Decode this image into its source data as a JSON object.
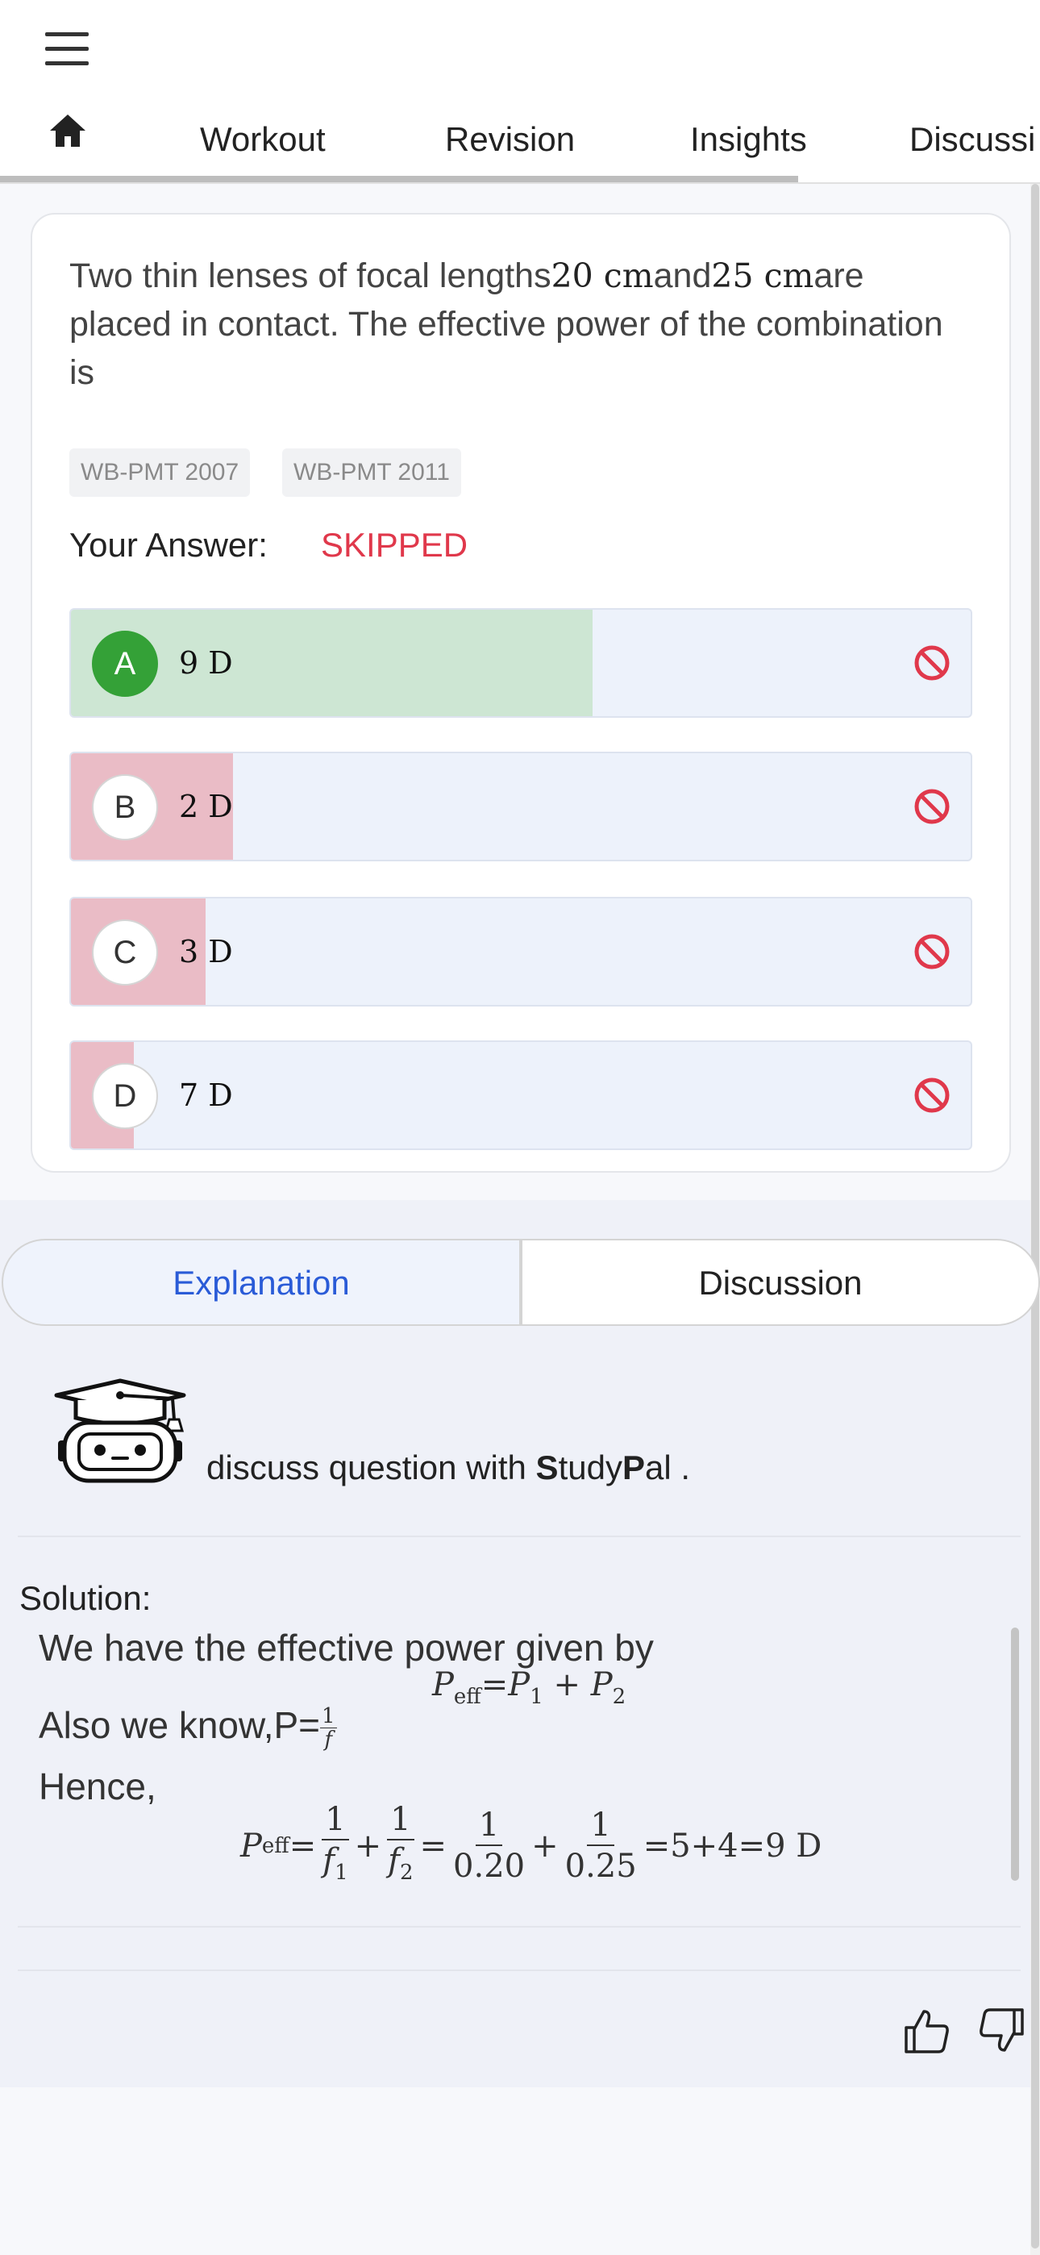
{
  "nav": {
    "tabs": [
      {
        "label": "Workout"
      },
      {
        "label": "Revision"
      },
      {
        "label": "Insights"
      },
      {
        "label": "Discussi"
      }
    ]
  },
  "question": {
    "text_parts": {
      "p1": "Two thin lenses of focal lengths",
      "v1": "20 cm",
      "p2": "and",
      "v2": "25 cm",
      "p3": "are placed in contact. The effective power of the combination is"
    },
    "tags": [
      "WB-PMT 2007",
      "WB-PMT 2011"
    ],
    "your_answer_label": "Your Answer:",
    "your_answer_value": "SKIPPED",
    "options": [
      {
        "letter": "A",
        "text": "9 D",
        "share": 0.58,
        "correct": true
      },
      {
        "letter": "B",
        "text": "2 D",
        "share": 0.18,
        "correct": false
      },
      {
        "letter": "C",
        "text": "3 D",
        "share": 0.15,
        "correct": false
      },
      {
        "letter": "D",
        "text": "7 D",
        "share": 0.07,
        "correct": false
      }
    ]
  },
  "panel": {
    "tab_explanation": "Explanation",
    "tab_discussion": "Discussion",
    "studypal": {
      "prefix": "discuss question with ",
      "s": "S",
      "tudy": "tudy",
      "p": "P",
      "al": "al ."
    },
    "solution_title": "Solution:",
    "line1": "We have the effective power given by",
    "line2_text": "Also we know,P=",
    "line3": "Hence,",
    "math_result": "=5+4=9 D"
  },
  "colors": {
    "correct_fill": "#cde6d3",
    "wrong_fill": "#eabcc6",
    "skipped": "#e0384b",
    "accent": "#2a5bd7",
    "correct_badge": "#34a137"
  },
  "icons": [
    "hamburger-icon",
    "home-icon",
    "ban-icon",
    "robot-graduate-icon",
    "thumbs-up-icon",
    "thumbs-down-icon"
  ]
}
